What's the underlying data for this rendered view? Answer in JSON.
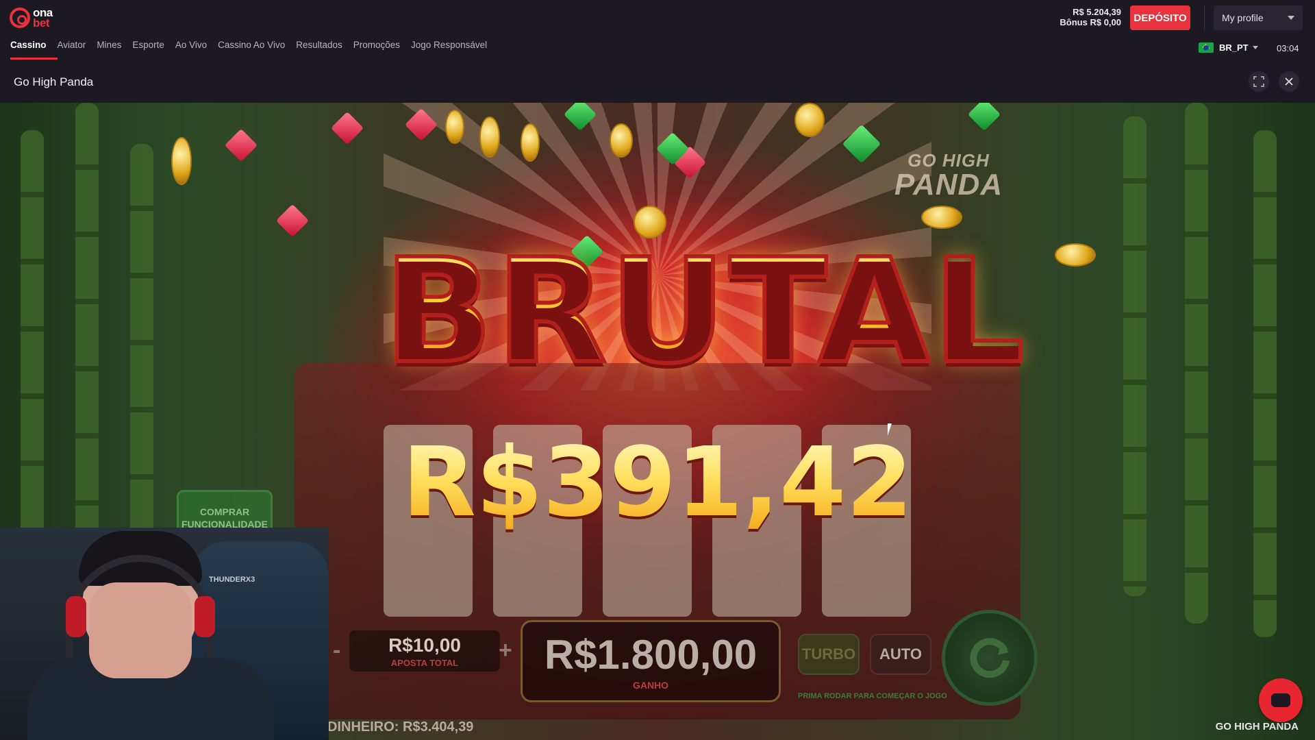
{
  "brand": {
    "logo_top": "ona",
    "logo_bottom": "bet"
  },
  "balance": {
    "main": "R$ 5.204,39",
    "bonus": "Bônus R$ 0,00"
  },
  "header": {
    "deposit_label": "DEPÓSITO",
    "profile_label": "My profile"
  },
  "nav": {
    "items": [
      {
        "label": "Cassino",
        "active": true
      },
      {
        "label": "Aviator"
      },
      {
        "label": "Mines"
      },
      {
        "label": "Esporte"
      },
      {
        "label": "Ao Vivo"
      },
      {
        "label": "Cassino Ao Vivo"
      },
      {
        "label": "Resultados"
      },
      {
        "label": "Promoções"
      },
      {
        "label": "Jogo Responsável"
      }
    ]
  },
  "locale": {
    "label": "BR_PT",
    "flag": "brazil-flag-icon"
  },
  "clock": "03:04",
  "game": {
    "title": "Go High Panda",
    "logo_line1": "GO HIGH",
    "logo_line2": "PANDA",
    "win_banner": "BRUTAL",
    "win_amount": "R$391,42",
    "buy_feature": "COMPRAR FUNCIONALIDADE",
    "bet_value": "R$10,00",
    "bet_label": "APOSTA TOTAL",
    "bet_minus": "-",
    "bet_plus": "+",
    "win_value": "R$1.800,00",
    "win_label": "GANHO",
    "turbo_label": "TURBO",
    "auto_label": "AUTO",
    "start_hint": "PRIMA RODAR PARA COMEÇAR O JOGO",
    "cash_label": "DINHEIRO:",
    "cash_value": "R$3.404,39",
    "footer_name": "GO HIGH PANDA"
  },
  "webcam": {
    "chair_brand": "THUNDERX3"
  },
  "colors": {
    "accent": "#e8323c",
    "bar_bg": "#1c1922"
  }
}
